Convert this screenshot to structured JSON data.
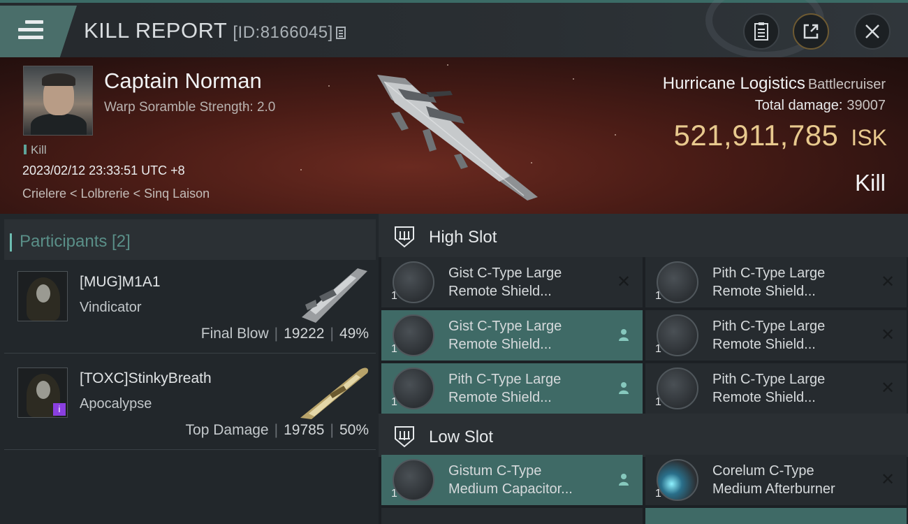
{
  "header": {
    "title": "KILL REPORT",
    "report_id": "[ID:8166045]",
    "icons": [
      "menu-icon",
      "copy-icon",
      "clipboard-icon",
      "share-icon",
      "close-icon"
    ]
  },
  "victim": {
    "name": "Captain Norman",
    "stat": "Warp Soramble Strength: 2.0",
    "tag": "Kill",
    "time": "2023/02/12 23:33:51 UTC +8",
    "location": "Crielere < Lolbrerie < Sinq Laison",
    "ship": "Hurricane Logistics",
    "ship_class": "Battlecruiser",
    "damage_label": "Total damage:",
    "damage_value": "39007",
    "isk_amount": "521,911,785",
    "isk_unit": "ISK",
    "result": "Kill"
  },
  "participants": {
    "title": "Participants [2]",
    "rows": [
      {
        "name": "[MUG]M1A1",
        "ship": "Vindicator",
        "label": "Final Blow",
        "damage": "19222",
        "percent": "49%"
      },
      {
        "name": "[TOXC]StinkyBreath",
        "ship": "Apocalypse",
        "label": "Top Damage",
        "damage": "19785",
        "percent": "50%",
        "badge": "i"
      }
    ]
  },
  "fittings": {
    "high_slot_title": "High Slot",
    "low_slot_title": "Low Slot",
    "high_slot": [
      {
        "name1": "Gist C-Type Large",
        "name2": "Remote Shield...",
        "qty": "1",
        "state": "x"
      },
      {
        "name1": "Pith C-Type Large",
        "name2": "Remote Shield...",
        "qty": "1",
        "state": "x"
      },
      {
        "name1": "Gist C-Type Large",
        "name2": "Remote Shield...",
        "qty": "1",
        "state": "user"
      },
      {
        "name1": "Pith C-Type Large",
        "name2": "Remote Shield...",
        "qty": "1",
        "state": "x"
      },
      {
        "name1": "Pith C-Type Large",
        "name2": "Remote Shield...",
        "qty": "1",
        "state": "user"
      },
      {
        "name1": "Pith C-Type Large",
        "name2": "Remote Shield...",
        "qty": "1",
        "state": "x"
      }
    ],
    "low_slot": [
      {
        "name1": "Gistum C-Type",
        "name2": "Medium Capacitor...",
        "qty": "1",
        "state": "user"
      },
      {
        "name1": "Corelum C-Type",
        "name2": "Medium Afterburner",
        "qty": "1",
        "state": "x"
      }
    ]
  },
  "colors": {
    "accent_teal": "#3f6a66",
    "isk_gold": "#e8c98e",
    "banner_red": "#4a1c16"
  }
}
